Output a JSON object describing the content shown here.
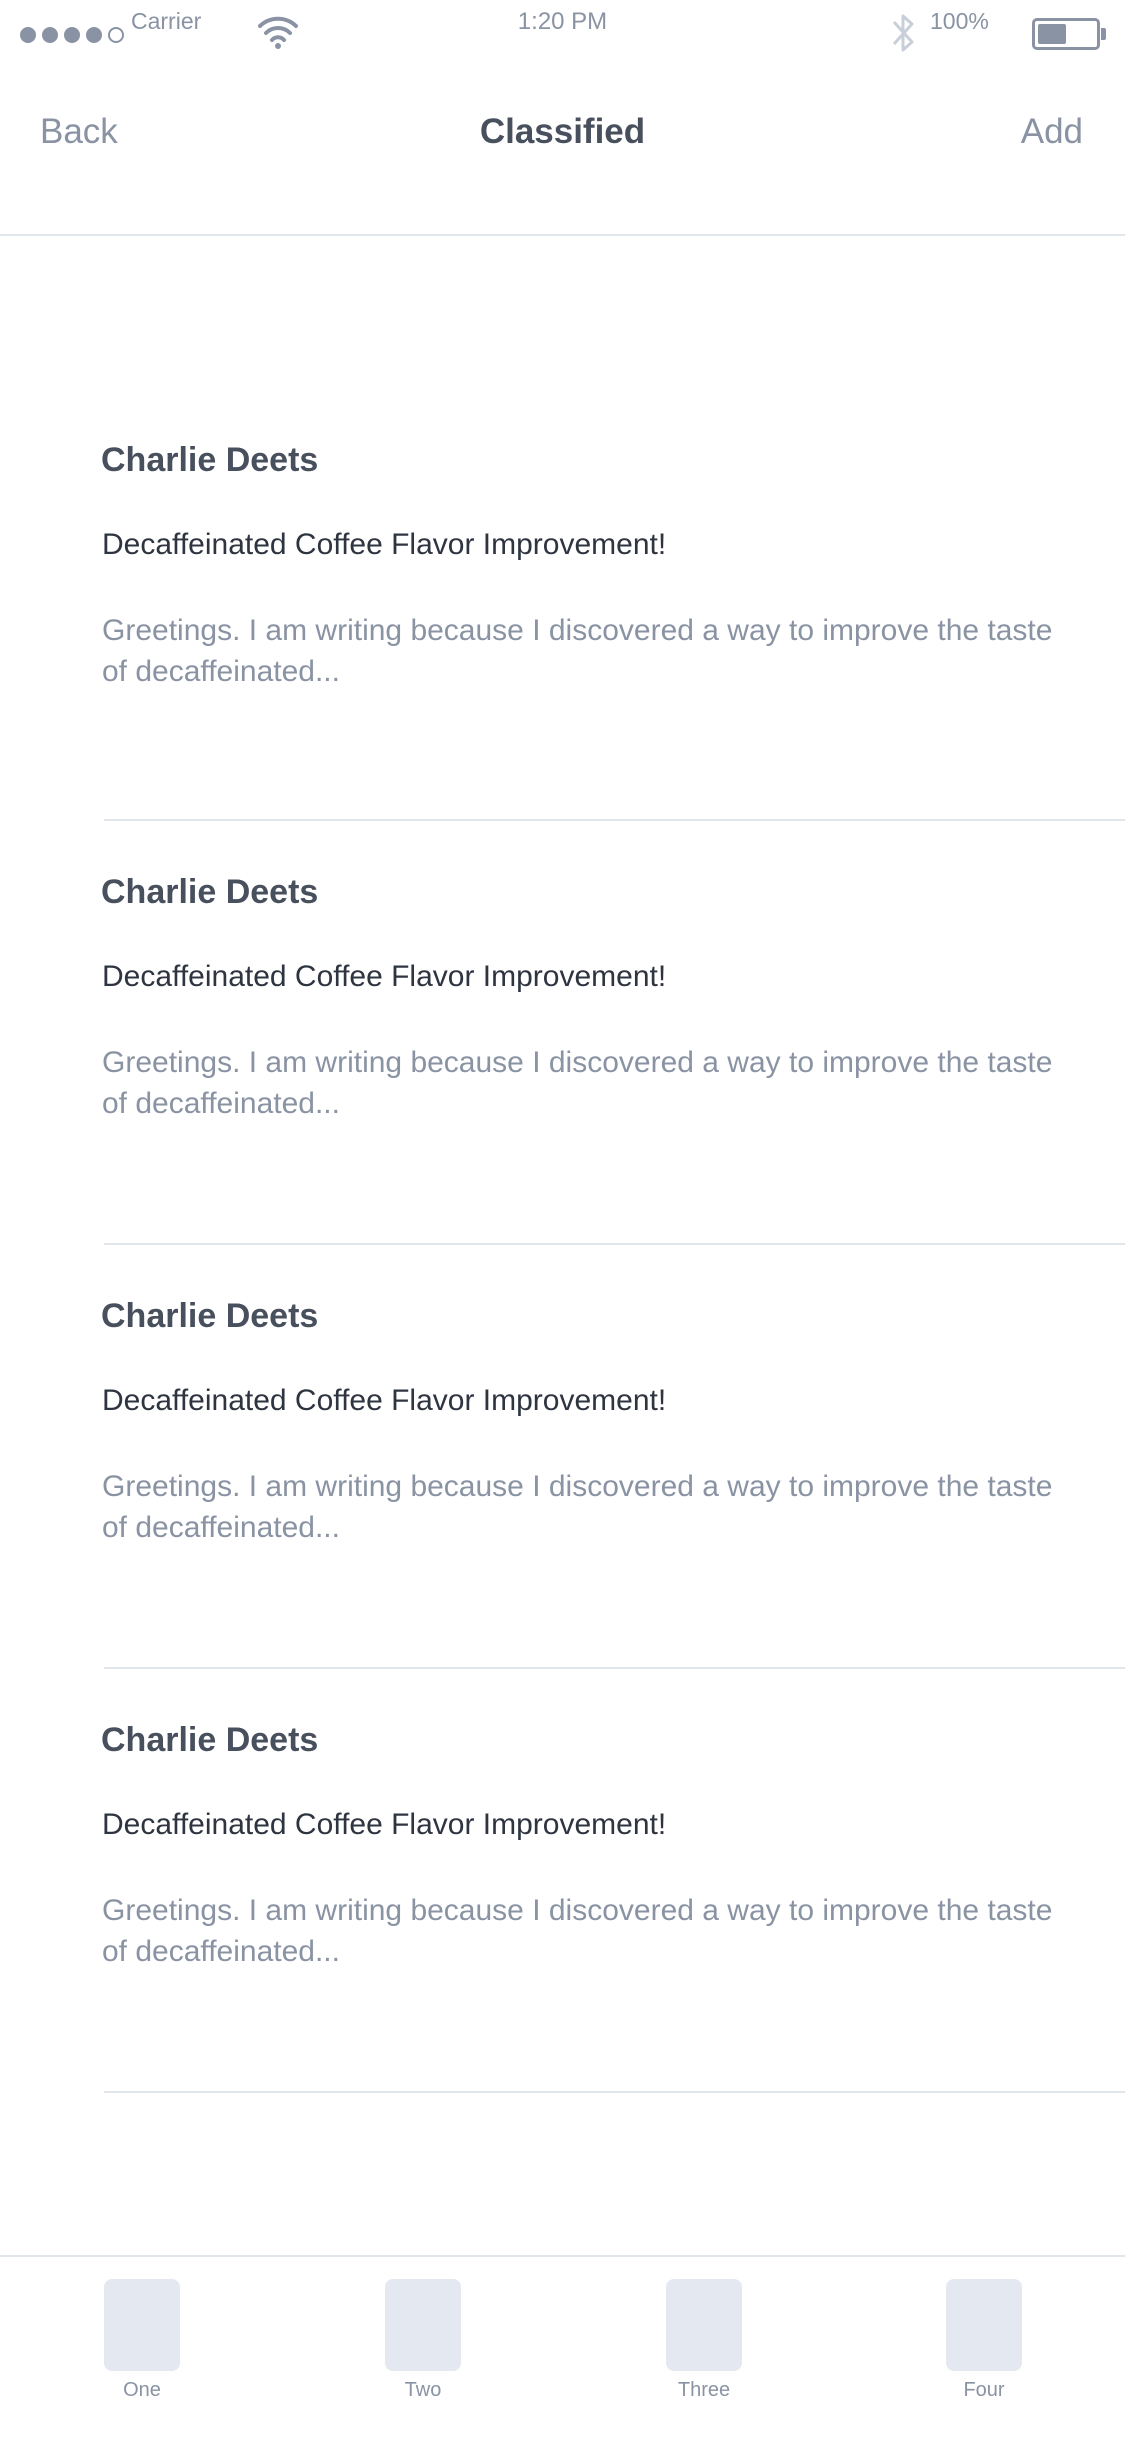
{
  "status": {
    "carrier": "Carrier",
    "time": "1:20 PM",
    "battery": "100%",
    "battery_level": 0.5
  },
  "nav": {
    "back_label": "Back",
    "title": "Classified",
    "add_label": "Add"
  },
  "messages": [
    {
      "sender": "Charlie Deets",
      "subject": "Decaffeinated Coffee Flavor Improvement!",
      "excerpt": "Greetings. I am writing because I discovered a way to improve the taste of decaffeinated..."
    },
    {
      "sender": "Charlie Deets",
      "subject": "Decaffeinated Coffee Flavor Improvement!",
      "excerpt": "Greetings. I am writing because I discovered a way to improve the taste of decaffeinated..."
    },
    {
      "sender": "Charlie Deets",
      "subject": "Decaffeinated Coffee Flavor Improvement!",
      "excerpt": "Greetings. I am writing because I discovered a way to improve the taste of decaffeinated..."
    },
    {
      "sender": "Charlie Deets",
      "subject": "Decaffeinated Coffee Flavor Improvement!",
      "excerpt": "Greetings. I am writing because I discovered a way to improve the taste of decaffeinated..."
    }
  ],
  "tabs": [
    {
      "label": "One",
      "icon": "placeholder-icon"
    },
    {
      "label": "Two",
      "icon": "placeholder-icon"
    },
    {
      "label": "Three",
      "icon": "placeholder-icon"
    },
    {
      "label": "Four",
      "icon": "placeholder-icon"
    }
  ],
  "colors": {
    "text_primary": "#48505e",
    "text_muted": "#8a93a3",
    "divider": "#e1e5ec",
    "tab_icon": "#e4e8f1"
  }
}
